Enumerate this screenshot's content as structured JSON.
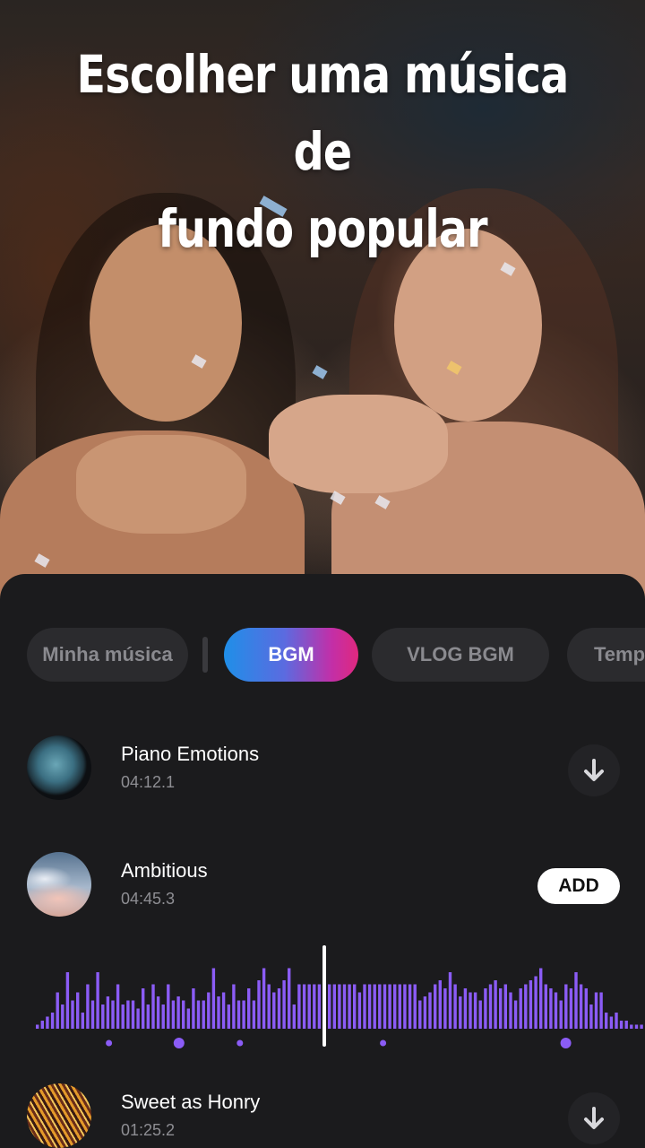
{
  "headline": {
    "line1": "Escolher uma música de",
    "line2": "fundo popular"
  },
  "tabs": [
    {
      "label": "Minha música",
      "active": false
    },
    {
      "label": "BGM",
      "active": true
    },
    {
      "label": "VLOG BGM",
      "active": false
    },
    {
      "label": "Temp",
      "active": false
    }
  ],
  "tracks": [
    {
      "title": "Piano Emotions",
      "duration": "04:12.1",
      "action": "download",
      "thumb": "piano-artwork"
    },
    {
      "title": "Ambitious",
      "duration": "04:45.3",
      "action": "add",
      "action_label": "ADD",
      "thumb": "cloudy-sky-artwork"
    },
    {
      "title": "Sweet as Honry",
      "duration": "01:25.2",
      "action": "download",
      "thumb": "strings-artwork"
    }
  ],
  "waveform": {
    "playhead_progress": 0.5,
    "color": "#8b5cf6",
    "amplitudes": [
      0.05,
      0.1,
      0.15,
      0.2,
      0.45,
      0.3,
      0.7,
      0.35,
      0.45,
      0.2,
      0.55,
      0.35,
      0.7,
      0.3,
      0.4,
      0.35,
      0.55,
      0.3,
      0.35,
      0.35,
      0.25,
      0.5,
      0.3,
      0.55,
      0.4,
      0.3,
      0.55,
      0.35,
      0.4,
      0.35,
      0.25,
      0.5,
      0.35,
      0.35,
      0.45,
      0.75,
      0.4,
      0.45,
      0.3,
      0.55,
      0.35,
      0.35,
      0.5,
      0.35,
      0.6,
      0.75,
      0.55,
      0.45,
      0.5,
      0.6,
      0.75,
      0.3,
      0.55,
      0.55,
      0.55,
      0.55,
      0.55,
      0.55,
      0.55,
      0.55,
      0.55,
      0.55,
      0.55,
      0.55,
      0.45,
      0.55,
      0.55,
      0.55,
      0.55,
      0.55,
      0.55,
      0.55,
      0.55,
      0.55,
      0.55,
      0.55,
      0.35,
      0.4,
      0.45,
      0.55,
      0.6,
      0.5,
      0.7,
      0.55,
      0.4,
      0.5,
      0.45,
      0.45,
      0.35,
      0.5,
      0.55,
      0.6,
      0.5,
      0.55,
      0.45,
      0.35,
      0.5,
      0.55,
      0.6,
      0.65,
      0.75,
      0.55,
      0.5,
      0.45,
      0.35,
      0.55,
      0.5,
      0.7,
      0.55,
      0.5,
      0.3,
      0.45,
      0.45,
      0.2,
      0.15,
      0.2,
      0.1,
      0.1,
      0.05,
      0.05,
      0.05
    ],
    "markers": [
      {
        "position": 0.12,
        "size": "small"
      },
      {
        "position": 0.235,
        "size": "large"
      },
      {
        "position": 0.335,
        "size": "small"
      },
      {
        "position": 0.57,
        "size": "small"
      },
      {
        "position": 0.87,
        "size": "large"
      }
    ]
  }
}
